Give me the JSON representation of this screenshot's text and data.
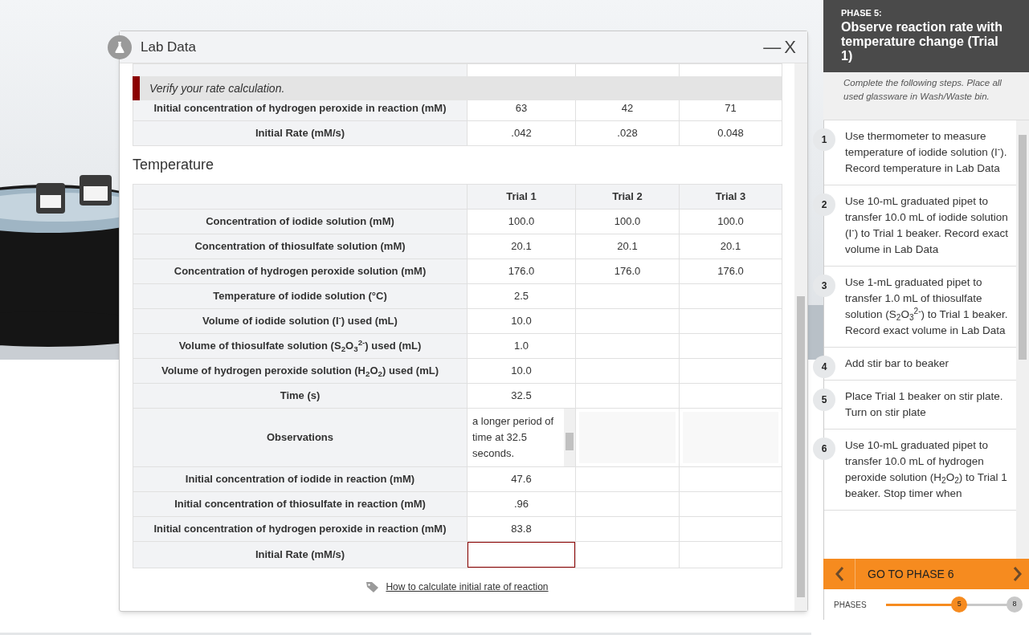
{
  "lab_data_window": {
    "title": "Lab Data",
    "minimize": "—",
    "close": "X",
    "alert": "Verify your rate calculation.",
    "previous_rows": [
      {
        "label": "Initial concentration of hydrogen peroxide in reaction (mM)",
        "cells": [
          {
            "kind": "text",
            "value": "63"
          },
          {
            "kind": "text",
            "value": "42"
          },
          {
            "kind": "text",
            "value": "71"
          }
        ]
      },
      {
        "label": "Initial Rate (mM/s)",
        "cells": [
          {
            "kind": "text",
            "value": ".042"
          },
          {
            "kind": "text",
            "value": ".028"
          },
          {
            "kind": "text",
            "value": "0.048"
          }
        ]
      }
    ],
    "section_title": "Temperature",
    "columns": [
      "Trial 1",
      "Trial 2",
      "Trial 3"
    ],
    "rows": [
      {
        "label": "Concentration of iodide solution (mM)",
        "cells": [
          {
            "kind": "text",
            "value": "100.0"
          },
          {
            "kind": "text",
            "value": "100.0"
          },
          {
            "kind": "text",
            "value": "100.0"
          }
        ]
      },
      {
        "label": "Concentration of thiosulfate solution (mM)",
        "cells": [
          {
            "kind": "text",
            "value": "20.1"
          },
          {
            "kind": "text",
            "value": "20.1"
          },
          {
            "kind": "text",
            "value": "20.1"
          }
        ]
      },
      {
        "label": "Concentration of hydrogen peroxide solution (mM)",
        "cells": [
          {
            "kind": "text",
            "value": "176.0"
          },
          {
            "kind": "text",
            "value": "176.0"
          },
          {
            "kind": "text",
            "value": "176.0"
          }
        ]
      },
      {
        "label": "Temperature of iodide solution (°C)",
        "cells": [
          {
            "kind": "text",
            "value": "2.5"
          },
          {
            "kind": "empty"
          },
          {
            "kind": "empty"
          }
        ]
      },
      {
        "label": "Volume of iodide solution (I$^{-}$) used (mL)",
        "cells": [
          {
            "kind": "text",
            "value": "10.0"
          },
          {
            "kind": "empty"
          },
          {
            "kind": "empty"
          }
        ]
      },
      {
        "label": "Volume of thiosulfate solution (S$_{2}$O$_{3}$$^{2-}$) used (mL)",
        "cells": [
          {
            "kind": "text",
            "value": "1.0"
          },
          {
            "kind": "empty"
          },
          {
            "kind": "empty"
          }
        ]
      },
      {
        "label": "Volume of hydrogen peroxide solution (H$_{2}$O$_{2}$) used (mL)",
        "cells": [
          {
            "kind": "text",
            "value": "10.0"
          },
          {
            "kind": "empty"
          },
          {
            "kind": "empty"
          }
        ]
      },
      {
        "label": "Time (s)",
        "cells": [
          {
            "kind": "text",
            "value": "32.5"
          },
          {
            "kind": "empty"
          },
          {
            "kind": "empty"
          }
        ]
      },
      {
        "label": "Observations",
        "cells": [
          {
            "kind": "textarea",
            "value": "a longer period of time at 32.5 seconds."
          },
          {
            "kind": "blank_area"
          },
          {
            "kind": "blank_area"
          }
        ]
      },
      {
        "label": "Initial concentration of iodide in reaction (mM)",
        "cells": [
          {
            "kind": "text",
            "value": "47.6"
          },
          {
            "kind": "empty"
          },
          {
            "kind": "empty"
          }
        ]
      },
      {
        "label": "Initial concentration of thiosulfate in reaction (mM)",
        "cells": [
          {
            "kind": "text",
            "value": ".96"
          },
          {
            "kind": "empty"
          },
          {
            "kind": "empty"
          }
        ]
      },
      {
        "label": "Initial concentration of hydrogen peroxide in reaction (mM)",
        "cells": [
          {
            "kind": "text",
            "value": "83.8"
          },
          {
            "kind": "empty"
          },
          {
            "kind": "empty"
          }
        ]
      },
      {
        "label": "Initial Rate (mM/s)",
        "cells": [
          {
            "kind": "input",
            "invalid": true
          },
          {
            "kind": "empty"
          },
          {
            "kind": "empty"
          }
        ]
      }
    ],
    "link": "How to calculate initial rate of reaction"
  },
  "phase_panel": {
    "phase_label": "PHASE 5:",
    "title": "Observe reaction rate with temperature change (Trial 1)",
    "instructions": "Complete the following steps. Place all used glassware in Wash/Waste bin.",
    "steps": [
      {
        "number": "1",
        "text": "Use thermometer to measure temperature of iodide solution (I$^{-}$). Record temperature in Lab Data"
      },
      {
        "number": "2",
        "text": "Use 10-mL graduated pipet to transfer 10.0 mL of iodide solution (I$^{-}$) to Trial 1 beaker. Record exact volume in Lab Data"
      },
      {
        "number": "3",
        "text": "Use 1-mL graduated pipet to transfer 1.0 mL of thiosulfate solution (S$_{2}$O$_{3}$$^{2-}$) to Trial 1 beaker. Record exact volume in Lab Data"
      },
      {
        "number": "4",
        "text": "Add stir bar to beaker"
      },
      {
        "number": "5",
        "text": "Place Trial 1 beaker on stir plate. Turn on stir plate"
      },
      {
        "number": "6",
        "text": "Use 10-mL graduated pipet to transfer 10.0 mL of hydrogen peroxide solution (H$_{2}$O$_{2}$) to Trial 1 beaker. Stop timer when"
      }
    ],
    "next_button": "GO TO PHASE 6",
    "phases": {
      "label": "PHASES",
      "current": "5",
      "total": "8",
      "level": 0.571
    }
  }
}
